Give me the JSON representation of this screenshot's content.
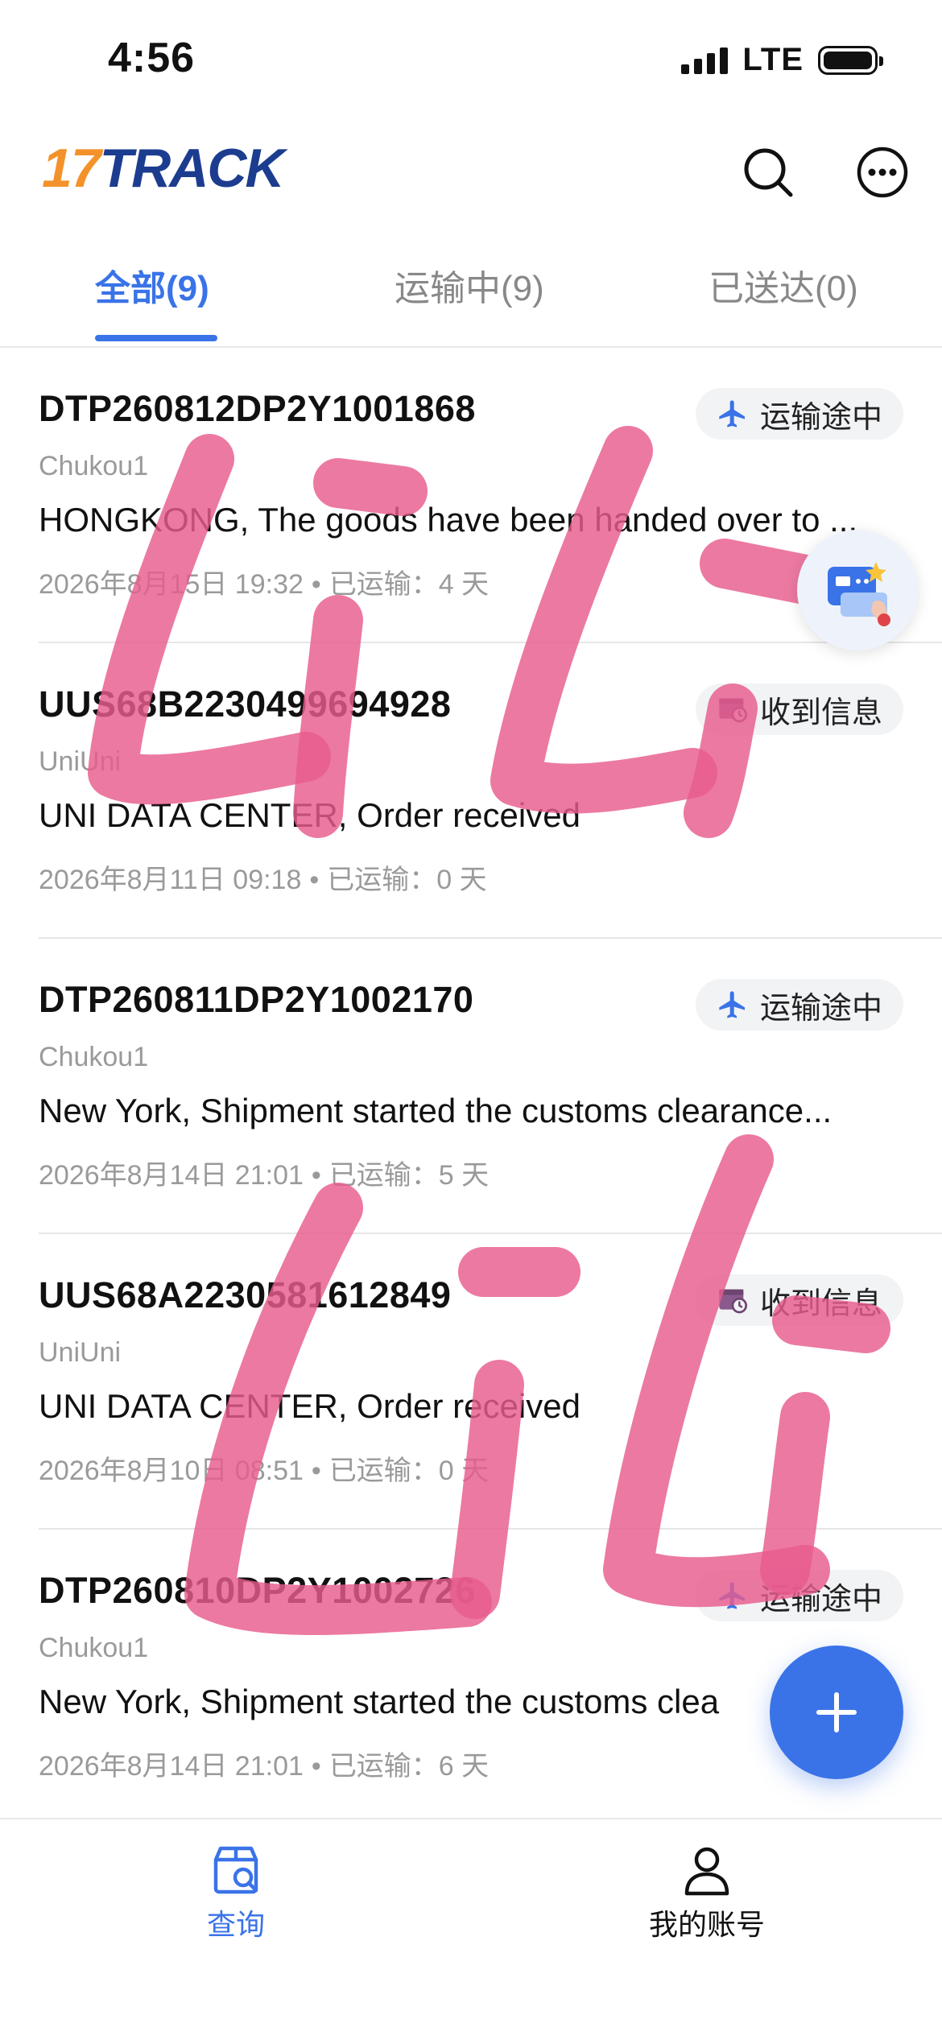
{
  "status_bar": {
    "time": "4:56",
    "network": "LTE"
  },
  "header": {
    "logo_number": "17",
    "logo_text": "TRACK",
    "search_icon": "search-icon",
    "more_icon": "more-icon"
  },
  "tabs": [
    {
      "label": "全部(9)",
      "active": true
    },
    {
      "label": "运输中(9)",
      "active": false
    },
    {
      "label": "已送达(0)",
      "active": false
    }
  ],
  "packages": [
    {
      "tracking_number": "DTP260812DP2Y1001868",
      "status": "运输途中",
      "status_icon": "airplane-icon",
      "carrier": "Chukou1",
      "latest_event": "HONGKONG, The goods have been handed over to ...",
      "date": "2026年8月15日 19:32",
      "transit": "已运输：4 天"
    },
    {
      "tracking_number": "UUS68B2230499694928",
      "status": "收到信息",
      "status_icon": "info-received-icon",
      "carrier": "UniUni",
      "latest_event": "UNI DATA CENTER, Order received",
      "date": "2026年8月11日 09:18",
      "transit": "已运输：0 天"
    },
    {
      "tracking_number": "DTP260811DP2Y1002170",
      "status": "运输途中",
      "status_icon": "airplane-icon",
      "carrier": "Chukou1",
      "latest_event": "New York, Shipment started the customs clearance...",
      "date": "2026年8月14日 21:01",
      "transit": "已运输：5 天"
    },
    {
      "tracking_number": "UUS68A2230581612849",
      "status": "收到信息",
      "status_icon": "info-received-icon",
      "carrier": "UniUni",
      "latest_event": "UNI DATA CENTER, Order received",
      "date": "2026年8月10日 08:51",
      "transit": "已运输：0 天"
    },
    {
      "tracking_number": "DTP260810DP2Y1002726",
      "status": "运输途中",
      "status_icon": "airplane-icon",
      "carrier": "Chukou1",
      "latest_event": "New York, Shipment started the customs clea",
      "date": "2026年8月14日 21:01",
      "transit": "已运输：6 天"
    }
  ],
  "separator": "•",
  "bottom_nav": [
    {
      "label": "查询",
      "icon": "package-search-icon",
      "active": true
    },
    {
      "label": "我的账号",
      "icon": "person-icon",
      "active": false
    }
  ],
  "colors": {
    "accent": "#3A73E8",
    "logo_orange": "#F3922A",
    "logo_navy": "#1C3D8F",
    "scribble_pink": "#E85C8E"
  }
}
